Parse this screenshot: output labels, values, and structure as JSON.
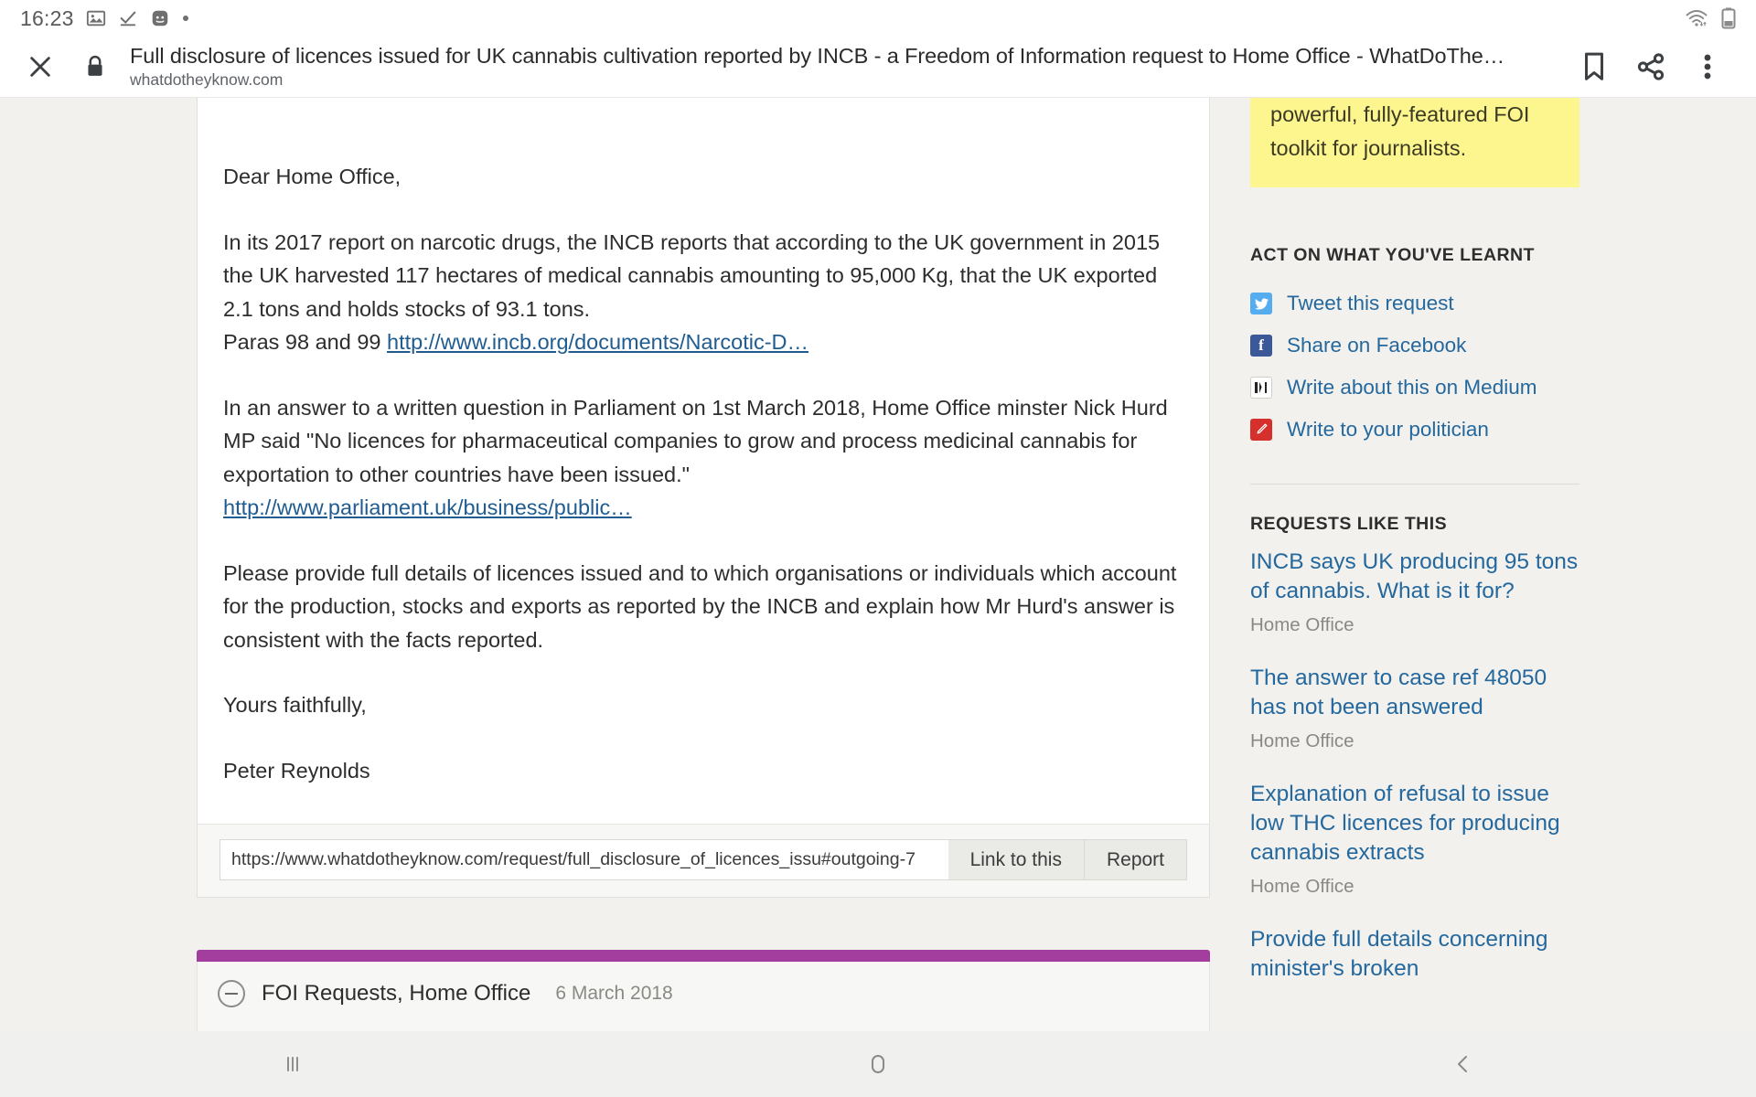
{
  "status_bar": {
    "clock": "16:23",
    "icons": [
      "image-icon",
      "download-complete-icon",
      "app-notification-icon",
      "more-dot-icon"
    ],
    "right_icons": [
      "wifi-icon",
      "battery-icon"
    ]
  },
  "browser": {
    "close_label": "×",
    "security_icon": "lock-icon",
    "title": "Full disclosure of licences issued for UK cannabis cultivation reported by INCB - a Freedom of Information request to Home Office - WhatDoThe…",
    "origin": "whatdotheyknow.com",
    "actions": [
      "bookmark-icon",
      "share-icon",
      "overflow-menu-icon"
    ]
  },
  "message": {
    "paragraphs": [
      {
        "text": "Dear Home Office,"
      },
      {
        "text": "In its 2017 report on narcotic drugs, the INCB reports that according to the UK government in 2015 the UK harvested 117 hectares of medical cannabis amounting to 95,000 Kg, that the UK exported 2.1 tons and holds stocks of 93.1 tons."
      },
      {
        "text": "In an answer to a written question in Parliament on 1st March 2018, Home Office minster Nick Hurd MP said \"No licences for pharmaceutical companies to grow and process medicinal cannabis for exportation to other countries have been issued.\""
      },
      {
        "text": "Please provide full details of licences issued and to which organisations or individuals which account for the production, stocks and exports as reported by the INCB and explain how Mr Hurd's answer is consistent with the facts reported."
      },
      {
        "text": "Yours faithfully,"
      },
      {
        "text": "Peter Reynolds"
      }
    ],
    "paras_prefix": "Paras 98 and 99 ",
    "link_incb": "http://www.incb.org/documents/Narcotic-D…",
    "link_parliament": "http://www.parliament.uk/business/public…",
    "footer": {
      "url_value": "https://www.whatdotheyknow.com/request/full_disclosure_of_licences_issu#outgoing-7",
      "link_to_this_label": "Link to this",
      "report_label": "Report"
    }
  },
  "next_correspondence": {
    "title": "FOI Requests, Home Office",
    "date": "6 March 2018",
    "accent_color": "#a43e9e"
  },
  "sidebar": {
    "promo_text": "powerful, fully-featured FOI toolkit for journalists.",
    "promo_bg": "#fdf68f",
    "act_heading": "ACT ON WHAT YOU'VE LEARNT",
    "actions": [
      {
        "label": "Tweet this request",
        "icon": "twitter-icon",
        "color": "#55acee"
      },
      {
        "label": "Share on Facebook",
        "icon": "facebook-icon",
        "color": "#3b5998"
      },
      {
        "label": "Write about this on Medium",
        "icon": "medium-icon",
        "color": "#ffffff"
      },
      {
        "label": "Write to your politician",
        "icon": "writetothem-pencil-icon",
        "color": "#d6302c"
      }
    ],
    "requests_heading": "REQUESTS LIKE THIS",
    "requests": [
      {
        "title": "INCB says UK producing 95 tons of cannabis. What is it for?",
        "authority": "Home Office"
      },
      {
        "title": "The answer to case ref 48050 has not been answered",
        "authority": "Home Office"
      },
      {
        "title": "Explanation of refusal to issue low THC licences for producing cannabis extracts",
        "authority": "Home Office"
      },
      {
        "title": "Provide full details concerning minister's broken",
        "authority": ""
      }
    ],
    "link_color": "#24689e"
  },
  "nav_bar": {
    "buttons": [
      "recents-icon",
      "home-icon",
      "back-icon"
    ]
  }
}
